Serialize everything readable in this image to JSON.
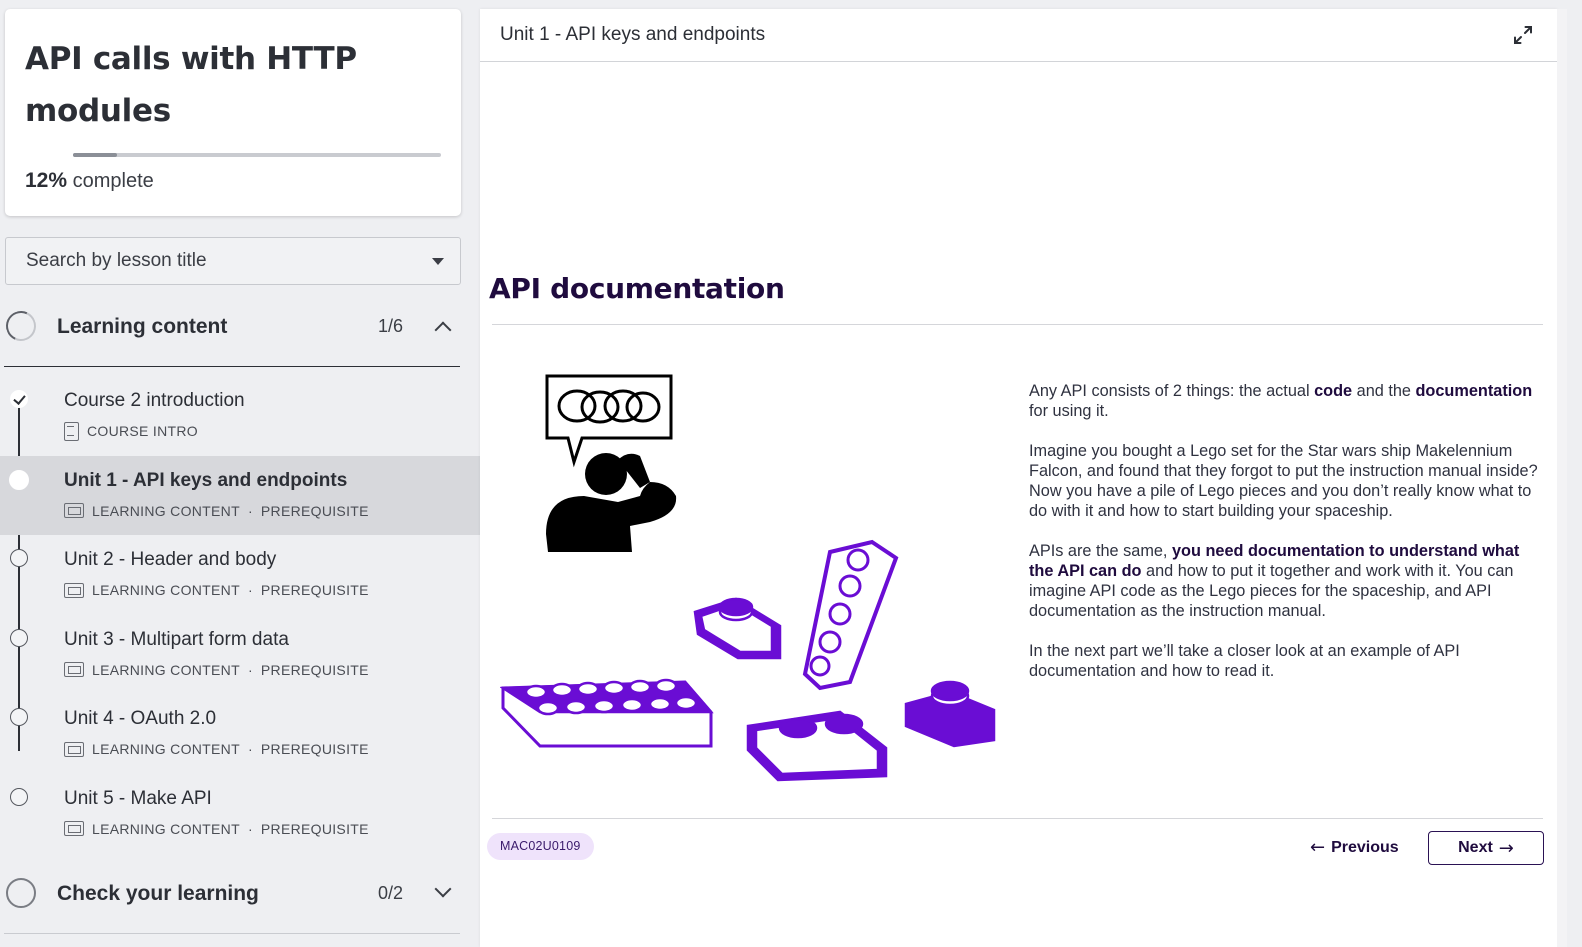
{
  "course": {
    "title": "API calls with HTTP modules",
    "progress_percent": 12,
    "progress_label": "12%",
    "progress_suffix": "complete"
  },
  "search": {
    "placeholder": "Search by lesson title"
  },
  "sections": [
    {
      "title": "Learning content",
      "count": "1/6",
      "expanded": true,
      "lessons": [
        {
          "title": "Course 2 introduction",
          "type": "COURSE INTRO",
          "tag": "",
          "status": "done"
        },
        {
          "title": "Unit 1 - API keys and endpoints",
          "type": "LEARNING CONTENT",
          "tag": "PREREQUISITE",
          "status": "current"
        },
        {
          "title": "Unit 2 - Header and body",
          "type": "LEARNING CONTENT",
          "tag": "PREREQUISITE",
          "status": "todo"
        },
        {
          "title": "Unit 3 - Multipart form data",
          "type": "LEARNING CONTENT",
          "tag": "PREREQUISITE",
          "status": "todo"
        },
        {
          "title": "Unit 4 - OAuth 2.0",
          "type": "LEARNING CONTENT",
          "tag": "PREREQUISITE",
          "status": "todo"
        },
        {
          "title": "Unit 5 - Make API",
          "type": "LEARNING CONTENT",
          "tag": "PREREQUISITE",
          "status": "todo"
        }
      ]
    },
    {
      "title": "Check your learning",
      "count": "0/2",
      "expanded": false
    }
  ],
  "meta_separator": "·",
  "content": {
    "header_title": "Unit 1 - API keys and endpoints",
    "heading": "API documentation",
    "paragraphs": [
      {
        "parts": [
          {
            "t": "Any API consists of 2 things: the actual ",
            "b": false
          },
          {
            "t": "code",
            "b": true
          },
          {
            "t": " and the ",
            "b": false
          },
          {
            "t": "documentation",
            "b": true
          },
          {
            "t": " for using it.",
            "b": false
          }
        ]
      },
      {
        "parts": [
          {
            "t": "Imagine you bought a Lego set for the Star wars ship Makelennium Falcon, and found that they forgot to put the instruction manual inside? Now you have a pile of Lego pieces and you don’t really know what to do with it and how to start building your spaceship.",
            "b": false
          }
        ]
      },
      {
        "parts": [
          {
            "t": "APIs are the same, ",
            "b": false
          },
          {
            "t": "you need documentation to understand what the API can do",
            "b": true
          },
          {
            "t": " and how to put it together and work with it. You can imagine API code as the Lego pieces for the spaceship, and API documentation as the instruction manual.",
            "b": false
          }
        ]
      },
      {
        "parts": [
          {
            "t": "In the next part we’ll take a closer look at an example of API documentation and how to read it.",
            "b": false
          }
        ]
      }
    ],
    "code_chip": "MAC02U0109",
    "prev_label": "Previous",
    "next_label": "Next",
    "prev_arrow": "←",
    "next_arrow": "→"
  },
  "colors": {
    "accent_purple": "#6a0dd4",
    "heading_dark": "#1f0b3e",
    "chip_bg": "#efe3fb"
  },
  "icons": {
    "expand": "expand-icon",
    "caret": "caret-down-icon",
    "lesson_doc": "course-intro-icon",
    "lesson_screen": "learning-content-icon"
  }
}
